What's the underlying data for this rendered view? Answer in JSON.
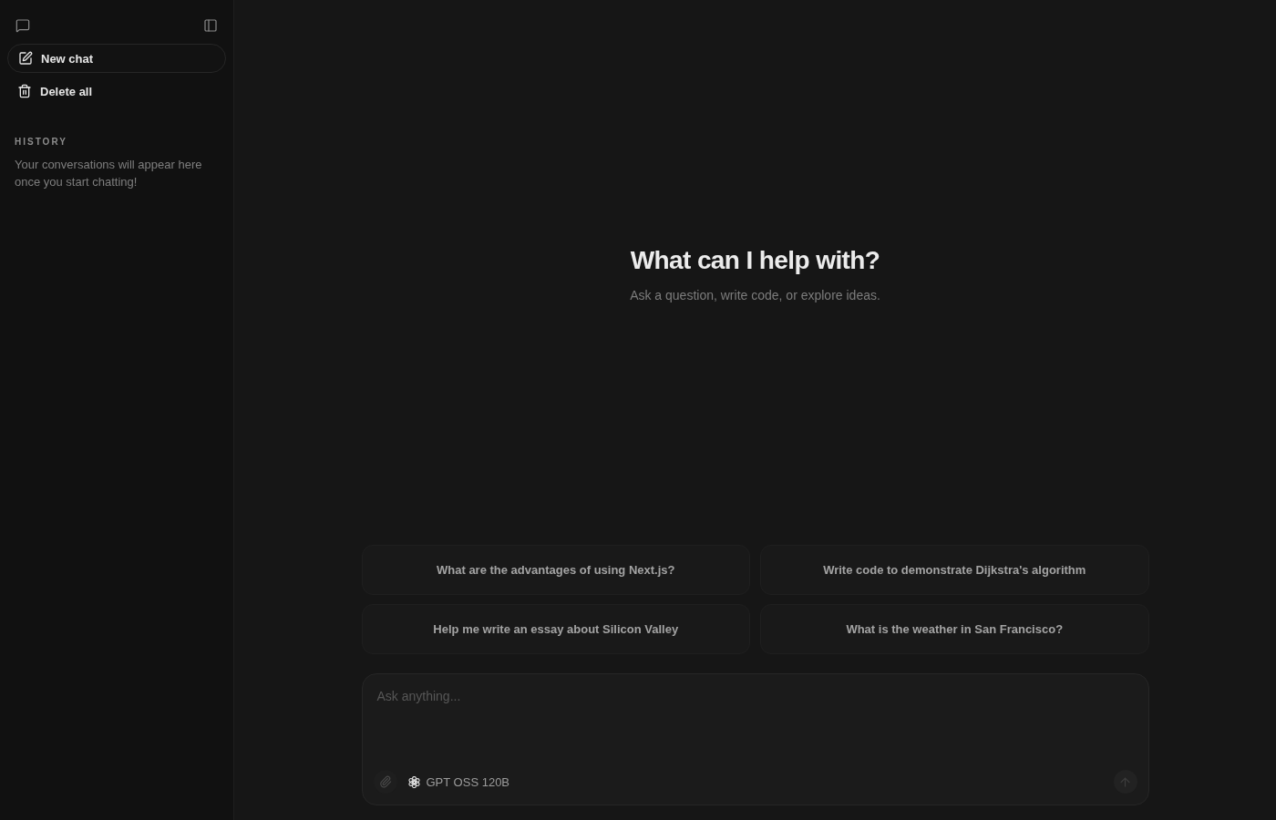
{
  "sidebar": {
    "actions": [
      {
        "kind": "new",
        "label": "New chat"
      },
      {
        "kind": "delete",
        "label": "Delete all"
      }
    ],
    "history": {
      "heading": "HISTORY",
      "empty_message": "Your conversations will appear here once you start chatting!"
    }
  },
  "hero": {
    "title": "What can I help with?",
    "subtitle": "Ask a question, write code, or explore ideas."
  },
  "suggestions": [
    "What are the advantages of using Next.js?",
    "Write code to demonstrate Dijkstra's algorithm",
    "Help me write an essay about Silicon Valley",
    "What is the weather in San Francisco?"
  ],
  "composer": {
    "placeholder": "Ask anything...",
    "model": "GPT OSS 120B",
    "send_disabled": true
  }
}
